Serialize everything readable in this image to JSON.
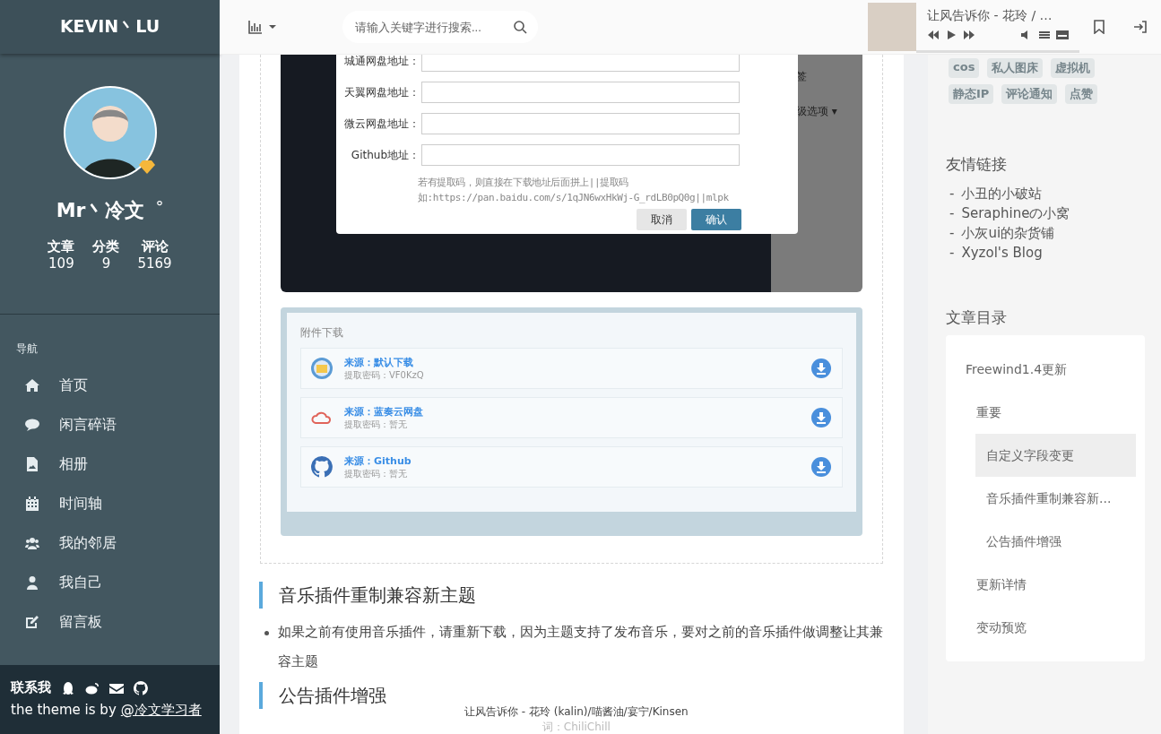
{
  "sidebar": {
    "brand": "KEVIN丶LU",
    "profile": {
      "name": "Mr丶冷文",
      "name_mark": "°",
      "stats": [
        {
          "label": "文章",
          "value": "109"
        },
        {
          "label": "分类",
          "value": "9"
        },
        {
          "label": "评论",
          "value": "5169"
        }
      ]
    },
    "nav_label": "导航",
    "nav": [
      {
        "kind": "home",
        "label": "首页"
      },
      {
        "kind": "chat",
        "label": "闲言碎语"
      },
      {
        "kind": "image",
        "label": "相册"
      },
      {
        "kind": "calendar",
        "label": "时间轴"
      },
      {
        "kind": "group",
        "label": "我的邻居"
      },
      {
        "kind": "user",
        "label": "我自己"
      },
      {
        "kind": "edit",
        "label": "留言板"
      }
    ],
    "footer": {
      "contact_label": "联系我",
      "contact_icons": [
        {
          "kind": "qq"
        },
        {
          "kind": "weibo"
        },
        {
          "kind": "mail"
        },
        {
          "kind": "github"
        }
      ],
      "credit": "the theme is by",
      "credit_link": "@冷文学习者"
    }
  },
  "topbar": {
    "search": {
      "placeholder": "请输入关键字进行搜索..."
    },
    "player": {
      "title": "让风告诉你 - 花玲 / …"
    }
  },
  "main": {
    "screenshot": {
      "dialog": {
        "fields": [
          {
            "label": "城通网盘地址："
          },
          {
            "label": "天翼网盘地址："
          },
          {
            "label": "微云网盘地址："
          },
          {
            "label": "Github地址："
          }
        ],
        "hint": [
          "若有提取码，则直接在下载地址后面拼上||提取码",
          "如:https://pan.baidu.com/s/1qJN6wxHkWj-G_rdLB0pQ0g||mlpk"
        ],
        "buttons": [
          {
            "kind": "secondary",
            "label": "取消"
          },
          {
            "kind": "primary",
            "label": "确认"
          }
        ]
      },
      "background_texts": [
        "签",
        "级选项 ▾"
      ]
    },
    "downloads": {
      "title": "附件下载",
      "items": [
        {
          "kind": "folder",
          "source": "来源：默认下载",
          "code": "提取密码：VF0KzQ"
        },
        {
          "kind": "cloud",
          "source": "来源：蓝奏云网盘",
          "code": "提取密码：暂无"
        },
        {
          "kind": "github",
          "source": "来源：Github",
          "code": "提取密码：暂无"
        }
      ]
    },
    "article": [
      {
        "kind": "heading",
        "text": "音乐插件重制兼容新主题"
      },
      {
        "kind": "bullet",
        "text": "如果之前有使用音乐插件，请重新下载，因为主题支持了发布音乐，要对之前的音乐插件做调整让其兼容主题"
      },
      {
        "kind": "heading",
        "text": "公告插件增强"
      }
    ]
  },
  "aside": {
    "tags": [
      "cos",
      "私人图床",
      "虚拟机",
      "静态IP",
      "评论通知",
      "点赞"
    ],
    "friends_title": "友情链接",
    "friends": [
      {
        "marker": "-",
        "label": "小丑的小破站"
      },
      {
        "marker": "-",
        "label": "Seraphineの小窝"
      },
      {
        "marker": "-",
        "label": "小灰ui的杂货铺"
      },
      {
        "marker": "-",
        "label": "Xyzol's Blog"
      }
    ],
    "toc_title": "文章目录",
    "toc": [
      {
        "label": "Freewind1.4更新",
        "selected": false,
        "children": [
          {
            "label": "重要",
            "selected": false,
            "children": [
              {
                "label": "自定义字段变更",
                "selected": true
              },
              {
                "label": "音乐插件重制兼容新...",
                "selected": false
              },
              {
                "label": "公告插件增强",
                "selected": false
              }
            ]
          },
          {
            "label": "更新详情",
            "selected": false
          },
          {
            "label": "变动预览",
            "selected": false
          }
        ]
      }
    ]
  },
  "lyrics": {
    "line": "让风告诉你 - 花玲 (kalin)/喵酱油/宴宁/Kinsen",
    "credit": "词：ChiliChill"
  }
}
